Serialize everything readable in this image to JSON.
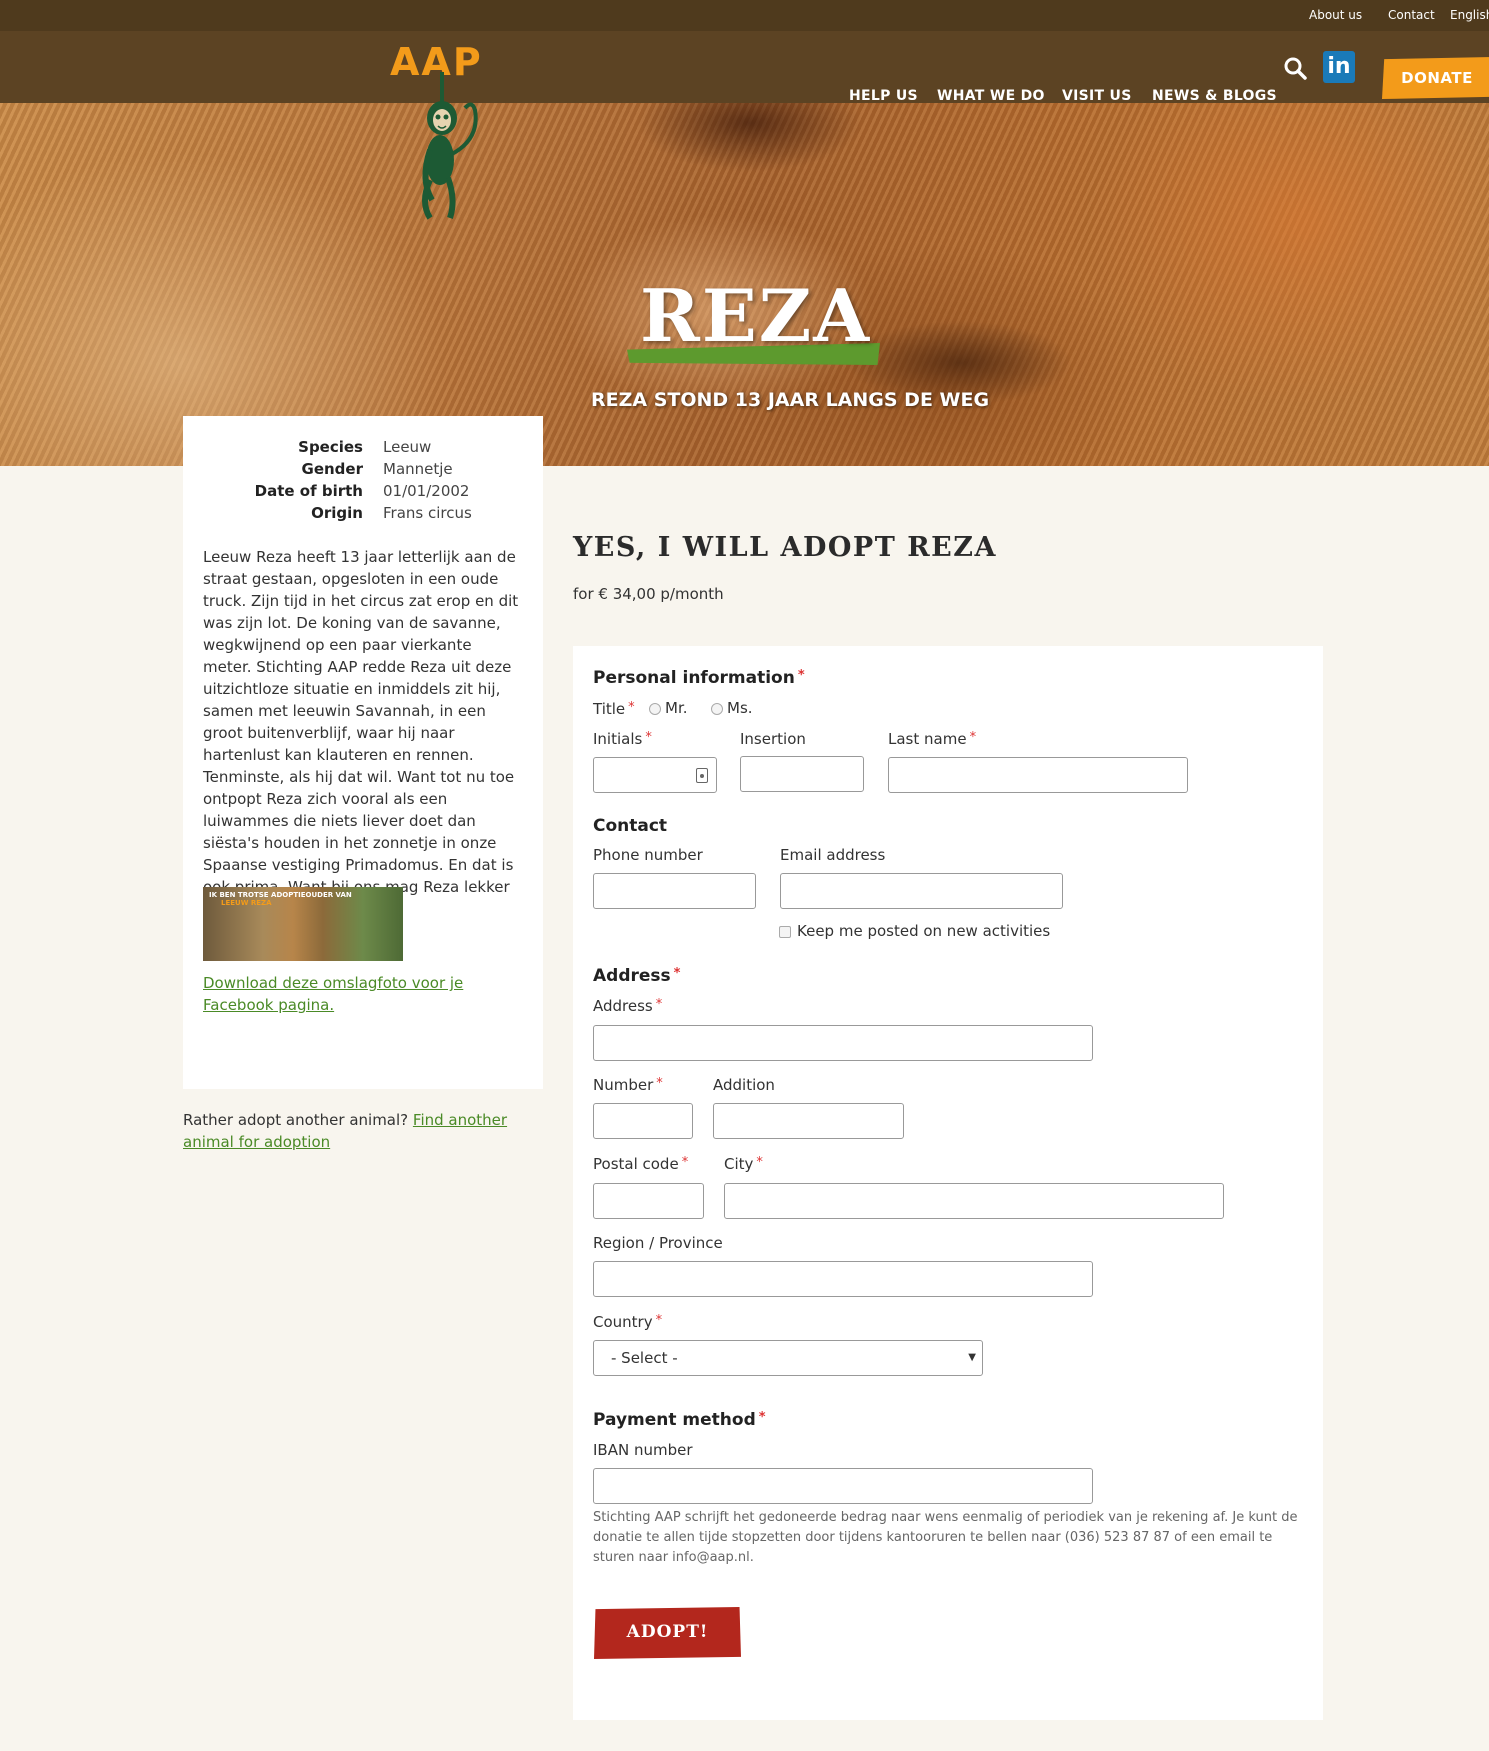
{
  "topbar": {
    "about": "About us",
    "contact": "Contact",
    "language": "English"
  },
  "nav": {
    "logo": "AAP",
    "items": [
      "HELP US",
      "WHAT WE DO",
      "VISIT US",
      "NEWS & BLOGS"
    ],
    "linkedin": "in",
    "donate": "DONATE"
  },
  "hero": {
    "title": "REZA",
    "subtitle": "REZA STOND 13 JAAR LANGS DE WEG"
  },
  "info": {
    "rows": [
      {
        "key": "Species",
        "value": "Leeuw"
      },
      {
        "key": "Gender",
        "value": "Mannetje"
      },
      {
        "key": "Date of birth",
        "value": "01/01/2002"
      },
      {
        "key": "Origin",
        "value": "Frans circus"
      }
    ],
    "story": "Leeuw Reza heeft 13 jaar letterlijk aan de straat gestaan, opgesloten in een oude truck. Zijn tijd in het circus zat erop en dit was zijn lot. De koning van de savanne, wegkwijnend op een paar vierkante meter. Stichting AAP redde Reza uit deze uitzichtloze situatie en inmiddels zit hij, samen met leeuwin Savannah, in een groot buitenverblijf, waar hij naar hartenlust kan klauteren en rennen. Tenminste, als hij dat wil. Want tot nu toe ontpopt Reza zich vooral als een luiwammes die niets liever doet dan siësta's houden in het zonnetje in onze Spaanse vestiging Primadomus. En dat is ook prima. Want bij ons mag Reza lekker zichzelf zijn!",
    "thumb_line1": "IK BEN TROTSE ADOPTIEOUDER VAN",
    "thumb_line2": "LEEUW REZA",
    "download_link": "Download deze omslagfoto voor je Facebook pagina.",
    "rather_text": "Rather adopt another animal? ",
    "rather_link": "Find another animal for adoption"
  },
  "form": {
    "heading": "YES, I WILL ADOPT REZA",
    "price": "for € 34,00 p/month",
    "personal": {
      "title": "Personal information",
      "title_label": "Title",
      "mr": "Mr.",
      "ms": "Ms.",
      "initials": "Initials",
      "insertion": "Insertion",
      "last_name": "Last name"
    },
    "contact": {
      "title": "Contact",
      "phone": "Phone number",
      "email": "Email address",
      "keep_posted": "Keep me posted on new activities"
    },
    "address": {
      "title": "Address",
      "address": "Address",
      "number": "Number",
      "addition": "Addition",
      "postal": "Postal code",
      "city": "City",
      "region": "Region / Province",
      "country": "Country",
      "country_value": "- Select -"
    },
    "payment": {
      "title": "Payment method",
      "iban": "IBAN number",
      "note": "Stichting AAP schrijft het gedoneerde bedrag naar wens eenmalig of periodiek van je rekening af. Je kunt de donatie te allen tijde stopzetten door tijdens kantooruren te bellen naar (036) 523 87 87 of een email te sturen naar info@aap.nl."
    },
    "submit": "ADOPT!"
  },
  "colors": {
    "topbar": "#4f3a1d",
    "nav": "#5c4323",
    "accent": "#f39b1a",
    "green": "#5d9a2e",
    "link": "#4a8a26",
    "button": "#b3271d",
    "page": "#f8f5ee"
  }
}
